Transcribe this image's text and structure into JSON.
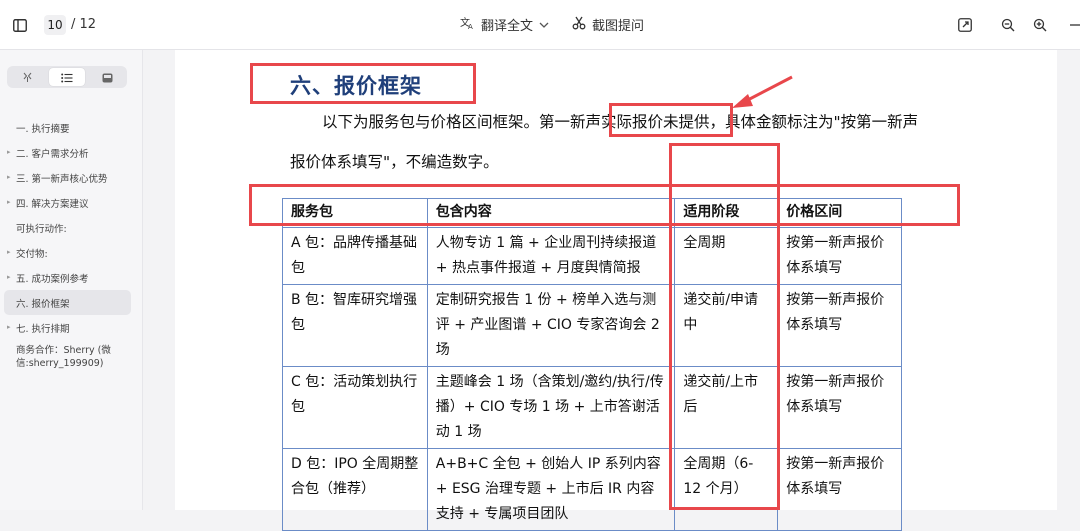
{
  "toolbar": {
    "page_current": "10",
    "page_total": "/ 12",
    "translate_label": "翻译全文",
    "screenshot_label": "截图提问"
  },
  "sidebar": {
    "toc": [
      {
        "label": "一. 执行摘要",
        "caret": false
      },
      {
        "label": "二. 客户需求分析",
        "caret": true
      },
      {
        "label": "三. 第一新声核心优势",
        "caret": true
      },
      {
        "label": "四. 解决方案建议",
        "caret": true
      },
      {
        "label": "可执行动作:",
        "caret": false
      },
      {
        "label": "交付物:",
        "caret": true
      },
      {
        "label": "五. 成功案例参考",
        "caret": true
      },
      {
        "label": "六. 报价框架",
        "caret": false,
        "active": true
      },
      {
        "label": "七. 执行排期",
        "caret": true
      },
      {
        "label": "商务合作：Sherry (微信:sherry_199909)",
        "caret": false
      }
    ]
  },
  "document": {
    "heading": "六、报价框架",
    "para_line1": "以下为服务包与价格区间框架。第一新声实际报价未提供，具体金额标注为\"按第一新声",
    "para_line2": "报价体系填写\"，不编造数字。",
    "table": {
      "headers": [
        "服务包",
        "包含内容",
        "适用阶段",
        "价格区间"
      ],
      "rows": [
        [
          "A 包：品牌传播基础包",
          "人物专访 1 篇 + 企业周刊持续报道 + 热点事件报道 + 月度舆情简报",
          "全周期",
          "按第一新声报价体系填写"
        ],
        [
          "B 包：智库研究增强包",
          "定制研究报告 1 份 + 榜单入选与测评 + 产业图谱 + CIO 专家咨询会 2 场",
          "递交前/申请中",
          "按第一新声报价体系填写"
        ],
        [
          "C 包：活动策划执行包",
          "主题峰会 1 场（含策划/邀约/执行/传播）+ CIO 专场 1 场 + 上市答谢活动 1 场",
          "递交前/上市后",
          "按第一新声报价体系填写"
        ],
        [
          "D 包：IPO 全周期整合包（推荐）",
          "A+B+C 全包 + 创始人 IP 系列内容 + ESG 治理专题 + 上市后 IR 内容支持 + 专属项目团队",
          "全周期（6-12 个月）",
          "按第一新声报价体系填写"
        ]
      ]
    }
  },
  "colors": {
    "heading": "#1f3f7a",
    "table_border": "#6b8cc7",
    "annotation": "#e8474b"
  }
}
